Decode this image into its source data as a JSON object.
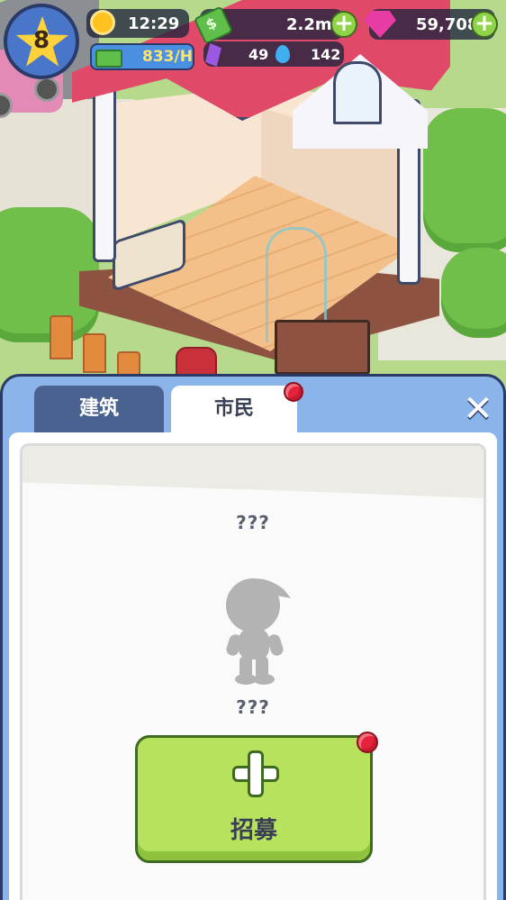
{
  "hud": {
    "level": "8",
    "time": "12:29",
    "cash": "2.2m",
    "gems": "59,708",
    "income": "833/H",
    "crystals": "49",
    "water": "142",
    "icons": [
      "star-icon",
      "sun-icon",
      "cash-icon",
      "gem-icon",
      "plus-icon",
      "income-icon",
      "crystal-icon",
      "water-drop-icon"
    ]
  },
  "panel": {
    "tabs": [
      {
        "label": "建筑",
        "selected": false
      },
      {
        "label": "市民",
        "selected": true,
        "notification": true
      }
    ],
    "close_icon": "close-icon",
    "citizen": {
      "title": "???",
      "name": "???"
    },
    "recruit_button": {
      "label": "招募",
      "notification": true
    }
  },
  "colors": {
    "panel_blue": "#8bb4ea",
    "tab_dark": "#4a6290",
    "recruit_green": "#b6e25e",
    "notification_red": "#e8213a",
    "roof_pink": "#e04a68"
  }
}
